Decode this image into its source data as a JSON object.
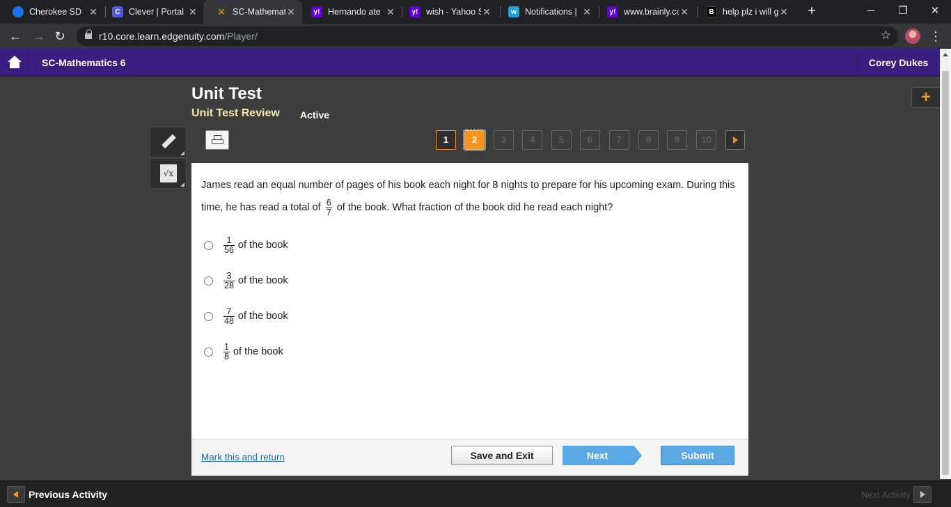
{
  "browser": {
    "tabs": [
      {
        "title": "Cherokee SD",
        "favicon": "cherokee-icon",
        "color": "#1a73e8",
        "glyph": ""
      },
      {
        "title": "Clever | Portal",
        "favicon": "clever-icon",
        "color": "#4f5bd5",
        "glyph": "C"
      },
      {
        "title": "SC-Mathemati",
        "favicon": "edgenuity-icon",
        "color": "#f7941d",
        "glyph": "✕"
      },
      {
        "title": "Hernando ate",
        "favicon": "yahoo-icon",
        "color": "#6001d2",
        "glyph": "y!"
      },
      {
        "title": "wish - Yahoo S",
        "favicon": "yahoo-icon",
        "color": "#6001d2",
        "glyph": "y!"
      },
      {
        "title": "Notifications |",
        "favicon": "wattpad-icon",
        "color": "#1da1d8",
        "glyph": "w"
      },
      {
        "title": "www.brainly.co",
        "favicon": "yahoo-icon",
        "color": "#6001d2",
        "glyph": "y!"
      },
      {
        "title": "help plz i will g",
        "favicon": "brainly-icon",
        "color": "#000000",
        "glyph": "B"
      }
    ],
    "active_tab": 2,
    "url_host": "r10.core.learn.edgenuity.com",
    "url_path": "/Player/"
  },
  "header": {
    "course": "SC-Mathematics 6",
    "user": "Corey Dukes"
  },
  "assessment": {
    "title": "Unit Test",
    "subtitle": "Unit Test Review",
    "status": "Active",
    "questions": [
      "1",
      "2",
      "3",
      "4",
      "5",
      "6",
      "7",
      "8",
      "9",
      "10"
    ],
    "current_question": 2
  },
  "question": {
    "text_part1": "James read an equal number of pages of his book each night for 8 nights to prepare for his upcoming exam. During this time, he has read a total of",
    "frac_num": "6",
    "frac_den": "7",
    "text_part2": "of the book. What fraction of the book did he read each night?",
    "choices": [
      {
        "num": "1",
        "den": "56",
        "suffix": "of the book"
      },
      {
        "num": "3",
        "den": "28",
        "suffix": "of the book"
      },
      {
        "num": "7",
        "den": "48",
        "suffix": "of the book"
      },
      {
        "num": "1",
        "den": "8",
        "suffix": "of the book"
      }
    ]
  },
  "footer": {
    "mark_link": "Mark this and return",
    "save_exit": "Save and Exit",
    "next": "Next",
    "submit": "Submit"
  },
  "activity_bar": {
    "previous": "Previous Activity",
    "next": "Next Activity"
  },
  "colors": {
    "header_purple": "#3a1f80",
    "accent_orange": "#f7941d",
    "button_blue": "#5aa8e4"
  }
}
